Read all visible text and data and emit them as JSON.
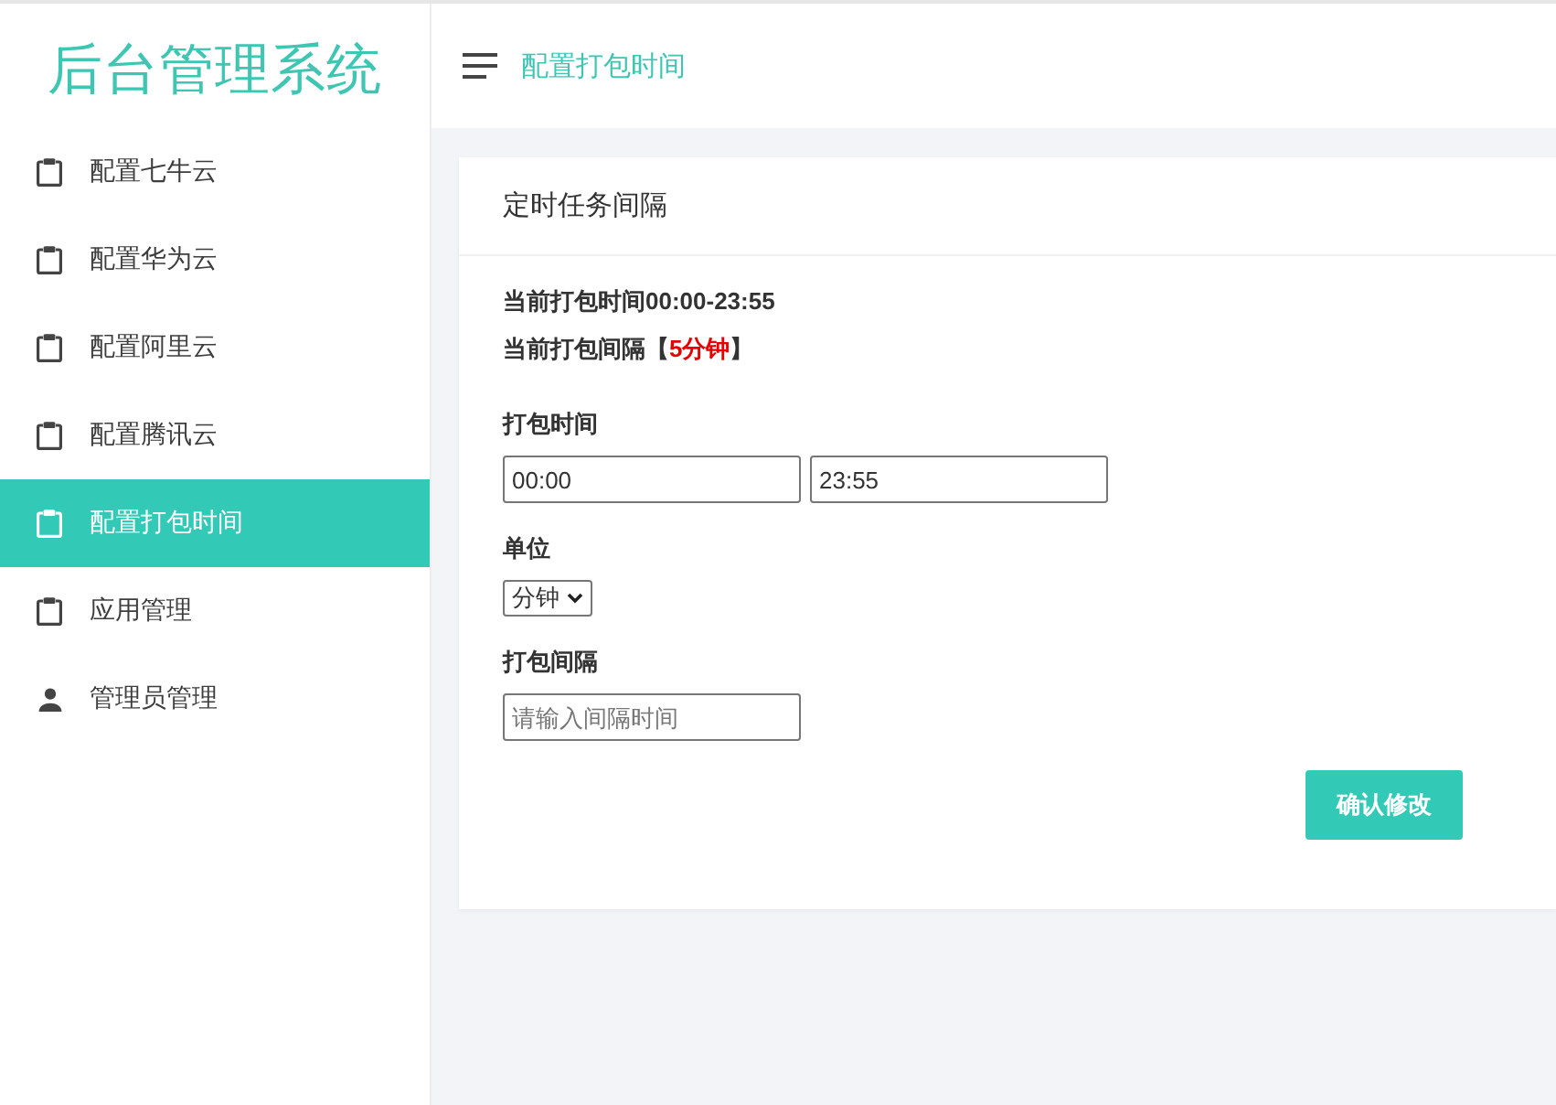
{
  "sidebar": {
    "title": "后台管理系统",
    "items": [
      {
        "label": "配置七牛云",
        "kind": "clipboard",
        "selected": false
      },
      {
        "label": "配置华为云",
        "kind": "clipboard",
        "selected": false
      },
      {
        "label": "配置阿里云",
        "kind": "clipboard",
        "selected": false
      },
      {
        "label": "配置腾讯云",
        "kind": "clipboard",
        "selected": false
      },
      {
        "label": "配置打包时间",
        "kind": "clipboard",
        "selected": true
      },
      {
        "label": "应用管理",
        "kind": "clipboard",
        "selected": false
      },
      {
        "label": "管理员管理",
        "kind": "person",
        "selected": false
      }
    ]
  },
  "header": {
    "breadcrumb": "配置打包时间"
  },
  "card": {
    "title": "定时任务间隔",
    "current_time": "当前打包时间00:00-23:55",
    "current_interval": {
      "before": "当前打包间隔【",
      "highlight": "5分钟",
      "after": "】"
    },
    "fields": [
      {
        "kind": "range",
        "label": "打包时间",
        "values": [
          "00:00",
          "23:55"
        ]
      },
      {
        "kind": "select",
        "label": "单位",
        "value": "分钟"
      },
      {
        "kind": "text",
        "label": "打包间隔",
        "placeholder": "请输入间隔时间"
      }
    ],
    "submit_button": "确认修改"
  }
}
